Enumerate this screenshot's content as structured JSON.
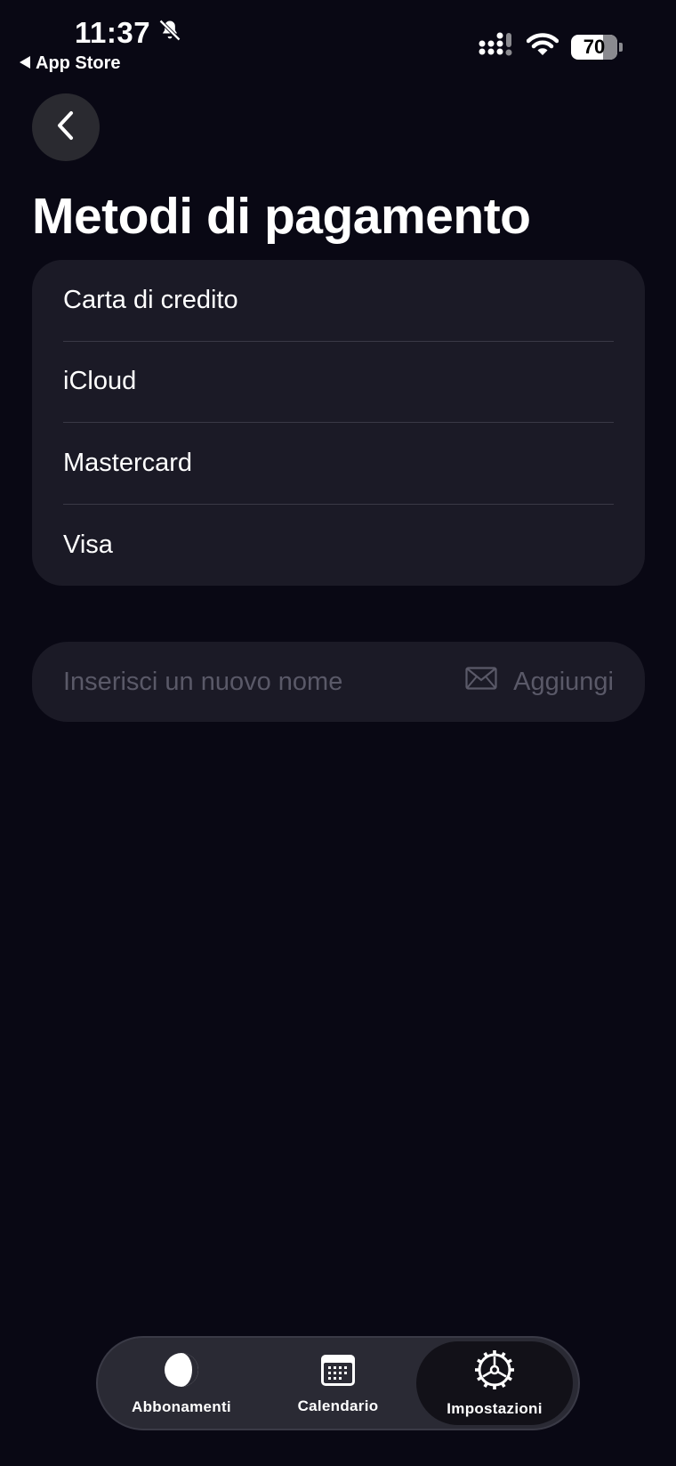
{
  "status_bar": {
    "time": "11:37",
    "back_label": "App Store",
    "battery": "70",
    "battery_level": 0.7,
    "icons": [
      "bell-slash-icon",
      "signal-icon",
      "wifi-icon",
      "battery-icon"
    ]
  },
  "header": {
    "back_icon": "chevron-left-icon",
    "title": "Metodi di pagamento"
  },
  "payment_methods": [
    {
      "label": "Carta di credito"
    },
    {
      "label": "iCloud"
    },
    {
      "label": "Mastercard"
    },
    {
      "label": "Visa"
    }
  ],
  "add_form": {
    "placeholder": "Inserisci un nuovo nome",
    "value": "",
    "button_label": "Aggiungi",
    "button_icon": "envelope-icon"
  },
  "tab_bar": {
    "tabs": [
      {
        "label": "Abbonamenti",
        "icon": "half-circle-icon",
        "active": false
      },
      {
        "label": "Calendario",
        "icon": "calendar-icon",
        "active": false
      },
      {
        "label": "Impostazioni",
        "icon": "gear-icon",
        "active": true
      }
    ]
  },
  "colors": {
    "background": "#090814",
    "card": "#1b1a26",
    "separator": "#3a3946",
    "placeholder": "#5a5968",
    "tab_bar": "#2a2a34",
    "tab_active": "#121118"
  }
}
